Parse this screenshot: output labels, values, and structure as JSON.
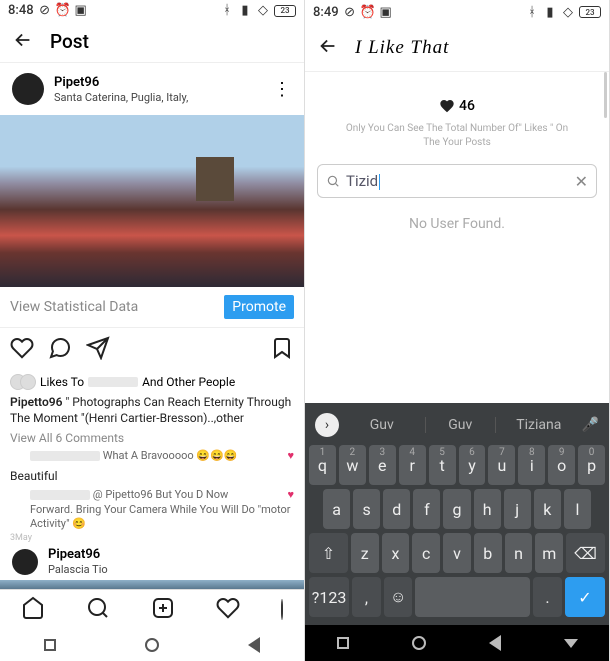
{
  "left": {
    "status": {
      "time": "8:48",
      "battery": "23"
    },
    "header": {
      "title": "Post"
    },
    "post": {
      "username": "Pipet96",
      "location": "Santa Caterina, Puglia, Italy,",
      "stat_link": "View Statistical Data",
      "promote": "Promote",
      "likes_prefix": "Likes To",
      "likes_suffix": "And Other People",
      "caption_user": "Pipetto96",
      "caption_text": "\" Photographs Can Reach Eternity Through The Moment \"(Henri Cartier-Bresson)..,other",
      "view_comments": "View All 6 Comments",
      "comment1": "What A Bravooooo 😄😄😄",
      "comment2_label": "Beautiful",
      "comment3_mention": "@ Pipetto96 But You D Now",
      "comment3_text": "Forward. Bring Your Camera While You Will Do \"motor Activity\" 😊",
      "date": "3May",
      "user2": "Pipeat96",
      "loc2": "Palascia Tio"
    }
  },
  "right": {
    "status": {
      "time": "8:49",
      "battery": "23"
    },
    "header": {
      "title": "I Like That"
    },
    "likes_count": "46",
    "info": "Only You Can See The Total Number Of\" Likes \" On The Your Posts",
    "search_value": "Tizid",
    "no_user": "No User Found.",
    "suggestions": {
      "s1": "Guv",
      "s2": "Guv",
      "s3": "Tiziana"
    },
    "keys_alt": "?123"
  }
}
